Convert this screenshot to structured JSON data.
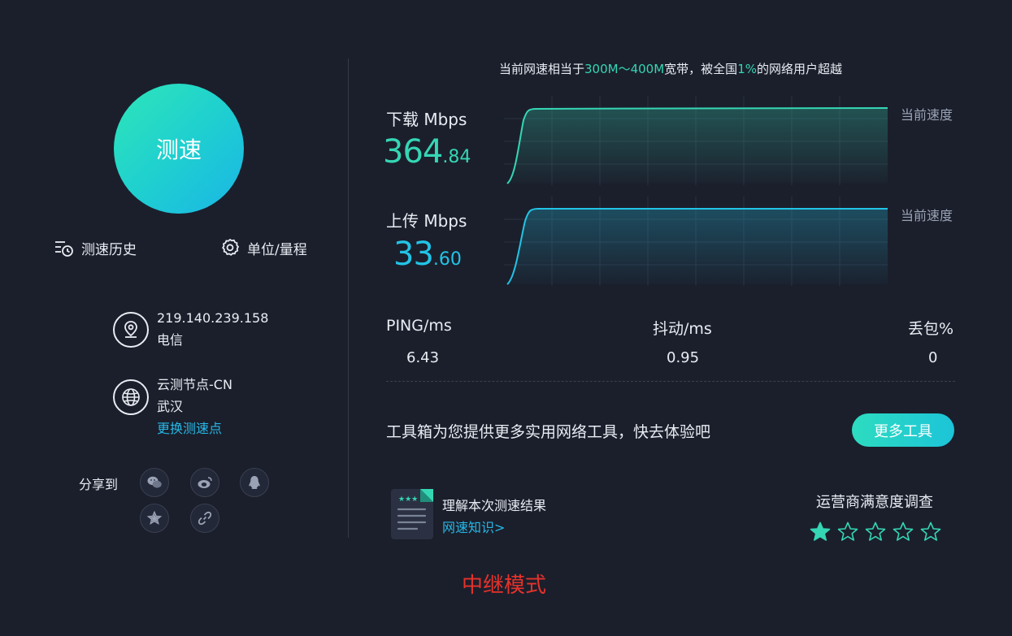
{
  "left": {
    "speed_button": "测速",
    "history_link": "测速历史",
    "unit_link": "单位/量程",
    "ip_address": "219.140.239.158",
    "isp": "电信",
    "node_name": "云测节点-CN",
    "node_city": "武汉",
    "change_node": "更换测速点",
    "share_label": "分享到"
  },
  "headline": {
    "prefix": "当前网速相当于",
    "range": "300M～400M",
    "middle": "宽带，被全国",
    "percent": "1%",
    "suffix": "的网络用户超越"
  },
  "download": {
    "label": "下载 Mbps",
    "value_int": "364",
    "value_dec": ".84",
    "current_label": "当前速度",
    "color": "#35d6b4"
  },
  "upload": {
    "label": "上传 Mbps",
    "value_int": "33",
    "value_dec": ".60",
    "current_label": "当前速度",
    "color": "#22c4e6"
  },
  "stats": {
    "ping_label": "PING/ms",
    "ping_value": "6.43",
    "jitter_label": "抖动/ms",
    "jitter_value": "0.95",
    "loss_label": "丢包%",
    "loss_value": "0"
  },
  "tools": {
    "text": "工具箱为您提供更多实用网络工具，快去体验吧",
    "button": "更多工具"
  },
  "knowledge": {
    "title": "理解本次测速结果",
    "link": "网速知识>"
  },
  "survey": {
    "title": "运营商满意度调查",
    "rating": 1,
    "max": 5
  },
  "mode_label": "中继模式"
}
